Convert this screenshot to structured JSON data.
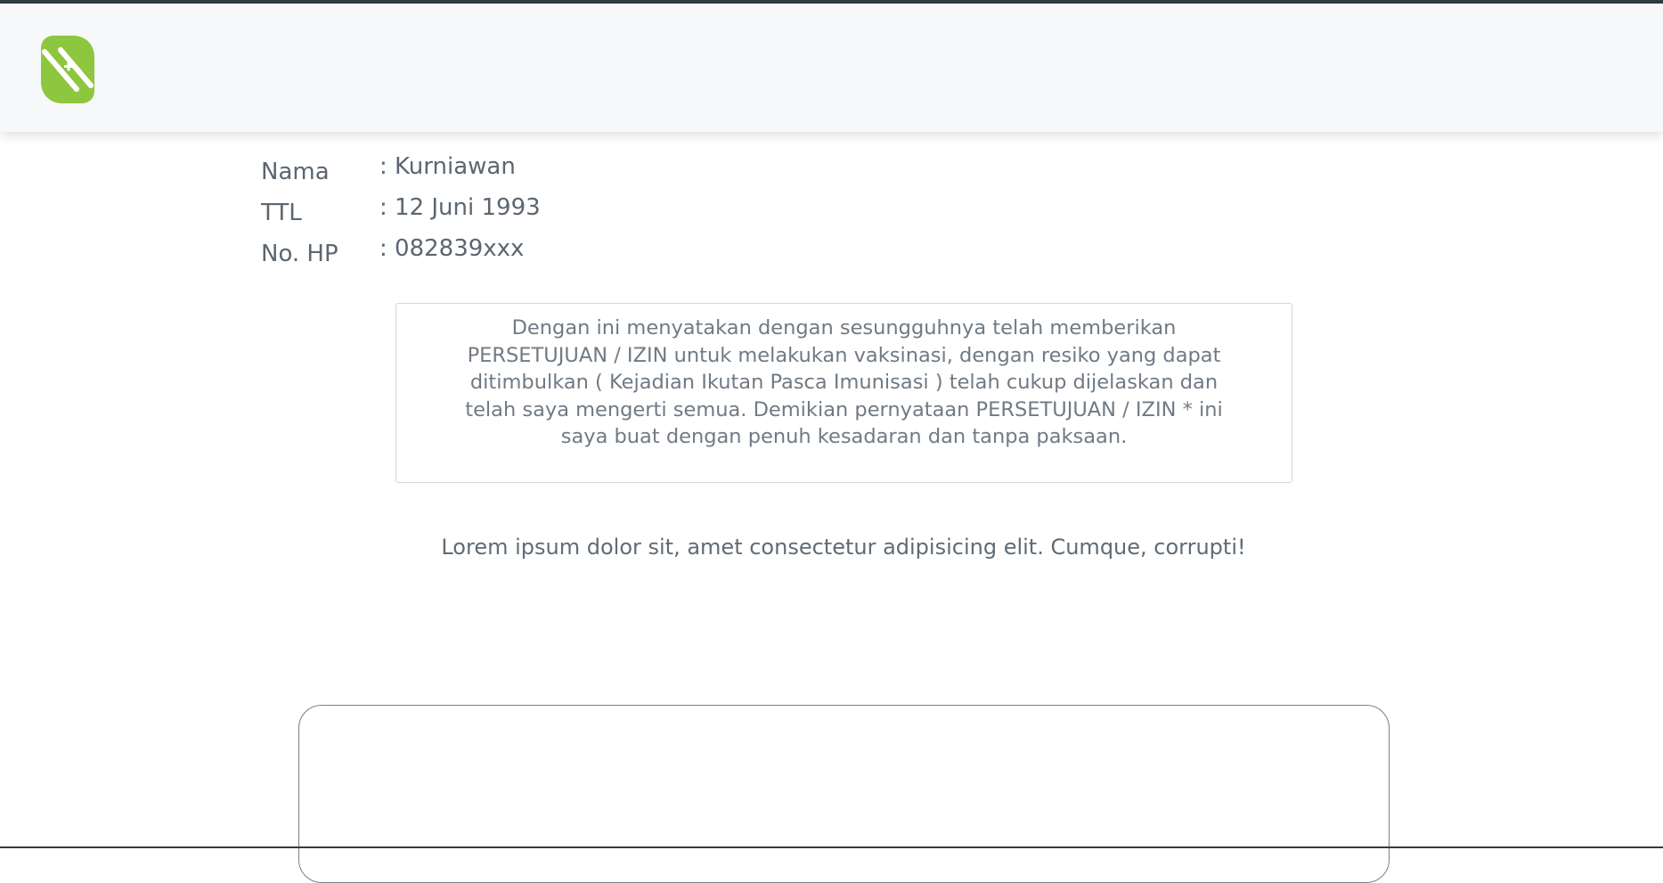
{
  "header": {
    "logo_icon": "shield-plus-icon",
    "logo_color": "#8dc63f"
  },
  "patient": {
    "rows": [
      {
        "label": "Nama",
        "value": ": Kurniawan"
      },
      {
        "label": "TTL",
        "value": ": 12 Juni 1993"
      },
      {
        "label": "No. HP",
        "value": ": 082839xxx"
      }
    ]
  },
  "consent": {
    "statement": "Dengan ini menyatakan dengan sesungguhnya telah memberikan PERSETUJUAN / IZIN untuk melakukan vaksinasi, dengan resiko yang dapat ditimbulkan ( Kejadian Ikutan Pasca Imunisasi ) telah cukup dijelaskan dan telah saya mengerti semua. Demikian pernyataan PERSETUJUAN / IZIN * ini saya buat dengan penuh kesadaran dan tanpa paksaan.",
    "note": "Lorem ipsum dolor sit, amet consectetur adipisicing elit. Cumque, corrupti!"
  },
  "colors": {
    "accent": "#8dc63f",
    "top_bar": "#2f3d45",
    "header_bg": "#f7f8fa",
    "text": "#5b6670"
  }
}
